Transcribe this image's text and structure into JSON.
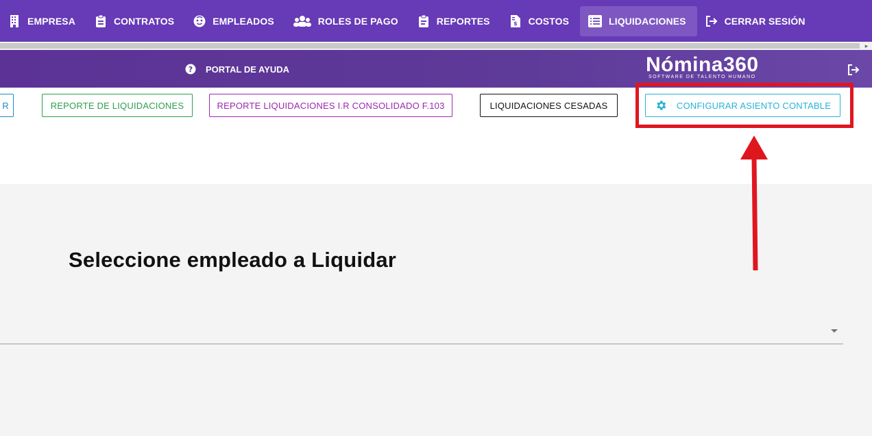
{
  "nav": [
    {
      "label": "EMPRESA",
      "icon": "building-icon"
    },
    {
      "label": "CONTRATOS",
      "icon": "clipboard-icon"
    },
    {
      "label": "EMPLEADOS",
      "icon": "face-icon"
    },
    {
      "label": "ROLES DE PAGO",
      "icon": "users-icon"
    },
    {
      "label": "REPORTES",
      "icon": "clipboard-list-icon"
    },
    {
      "label": "COSTOS",
      "icon": "file-invoice-dollar-icon"
    },
    {
      "label": "LIQUIDACIONES",
      "icon": "list-alt-icon",
      "active": true
    },
    {
      "label": "CERRAR SESIÓN",
      "icon": "sign-out-icon"
    }
  ],
  "subbar": {
    "help_label": "PORTAL DE AYUDA",
    "brand_name": "Nómina360",
    "brand_tagline": "SOFTWARE DE TALENTO HUMANO"
  },
  "toolbar": {
    "partial_label": "R",
    "reporte_liquidaciones": "REPORTE DE LIQUIDACIONES",
    "reporte_ir": "REPORTE LIQUIDACIONES I.R CONSOLIDADO F.103",
    "liquidaciones_cesadas": "LIQUIDACIONES CESADAS",
    "configurar_asiento": "CONFIGURAR ASIENTO CONTABLE"
  },
  "main": {
    "heading": "Seleccione empleado a Liquidar",
    "select_value": ""
  },
  "colors": {
    "nav_bg": "#673ab7",
    "nav_active": "#7e57c2",
    "annotation_red": "#e0161f"
  }
}
